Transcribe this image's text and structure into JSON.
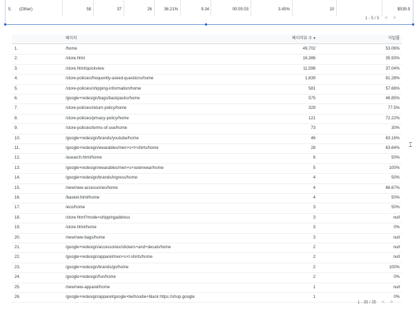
{
  "top_table": {
    "partial_row": {
      "cells": [
        "",
        "",
        "",
        "",
        "",
        "",
        "",
        "",
        "",
        ""
      ]
    },
    "row": {
      "no": "5.",
      "label": "(Other)",
      "c1": "58",
      "c2": "37",
      "c3": "26",
      "c4": "36.21%",
      "c5": "9.34",
      "c6": "00:05:03",
      "c7": "3.45%",
      "c8": "10",
      "c9": "$539.9"
    },
    "pager": "1 - 5 / 5"
  },
  "main_table": {
    "headers": {
      "page": "페이지",
      "views": "페이지뷰 수 ▾",
      "bounce": "이탈률"
    },
    "rows": [
      {
        "no": "1.",
        "page": "/home",
        "views": "49,702",
        "bounce": "53.06%"
      },
      {
        "no": "2.",
        "page": "/store.html",
        "views": "16,386",
        "bounce": "35.93%"
      },
      {
        "no": "3.",
        "page": "/store.html/quickview",
        "views": "11,598",
        "bounce": "37.04%"
      },
      {
        "no": "4.",
        "page": "/store-policies/frequently-asked-questions/home",
        "views": "1,639",
        "bounce": "81.28%"
      },
      {
        "no": "5.",
        "page": "/store-policies/shipping-information/home",
        "views": "581",
        "bounce": "57.66%"
      },
      {
        "no": "6.",
        "page": "/google+redesign/bags/backpacks/home",
        "views": "575",
        "bounce": "46.85%"
      },
      {
        "no": "7.",
        "page": "/store-policies/return-policy/home",
        "views": "329",
        "bounce": "77.5%"
      },
      {
        "no": "8.",
        "page": "/store-policies/privacy-policy/home",
        "views": "121",
        "bounce": "72.22%"
      },
      {
        "no": "9.",
        "page": "/store-policies/terms-of-use/home",
        "views": "73",
        "bounce": "30%"
      },
      {
        "no": "10.",
        "page": "/google+redesign/brands/youtube/home",
        "views": "46",
        "bounce": "63.16%"
      },
      {
        "no": "11.",
        "page": "/google+redesign/wearables/men+s+t+shirts/home",
        "views": "28",
        "bounce": "63.64%"
      },
      {
        "no": "12.",
        "page": "/asearch.html/home",
        "views": "6",
        "bounce": "50%"
      },
      {
        "no": "13.",
        "page": "/google+redesign/wearables/men+s+outerwear/home",
        "views": "5",
        "bounce": "100%"
      },
      {
        "no": "14.",
        "page": "/google+redesign/brands/ingress/home",
        "views": "4",
        "bounce": "50%"
      },
      {
        "no": "15.",
        "page": "/new/new-accessories/home",
        "views": "4",
        "bounce": "66.67%"
      },
      {
        "no": "16.",
        "page": "/basket.html/home",
        "views": "4",
        "bounce": "50%"
      },
      {
        "no": "17.",
        "page": "/eco/home",
        "views": "3",
        "bounce": "50%"
      },
      {
        "no": "18.",
        "page": "/store.html?mode=shippingaddress",
        "views": "3",
        "bounce": "null"
      },
      {
        "no": "19.",
        "page": "/store.html/home",
        "views": "3",
        "bounce": "0%"
      },
      {
        "no": "20.",
        "page": "/new/new-bags/home",
        "views": "3",
        "bounce": "null"
      },
      {
        "no": "21.",
        "page": "/google+redesign/accessories/stickers+and+decals/home",
        "views": "2",
        "bounce": "null"
      },
      {
        "no": "22.",
        "page": "/google+redesign/apparel/men+s+t-shirts/home",
        "views": "2",
        "bounce": "null"
      },
      {
        "no": "23.",
        "page": "/google+redesign/brands/go/home",
        "views": "2",
        "bounce": "100%"
      },
      {
        "no": "24.",
        "page": "/google+redesign/fun/home",
        "views": "2",
        "bounce": "0%"
      },
      {
        "no": "25.",
        "page": "/new/new-apparel/home",
        "views": "1",
        "bounce": "null"
      },
      {
        "no": "26.",
        "page": "/google+redesign/apparel/google+tie/hoodie+black https://shop.google",
        "views": "1",
        "bounce": "0%"
      }
    ],
    "pager": "1 - 35 / 35"
  },
  "colors": {
    "selection": "#2f6fd0",
    "header_bg": "#f8f9fa",
    "row_border": "#eef0f2"
  }
}
